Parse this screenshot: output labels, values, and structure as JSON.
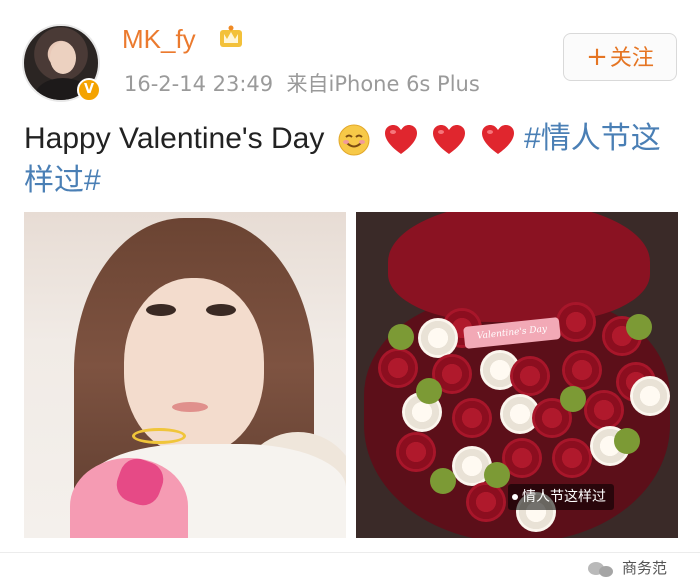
{
  "post": {
    "username": "MK_fy",
    "timestamp": "16-2-14 23:49",
    "source": "来自iPhone 6s Plus",
    "verified_badge": "V",
    "follow_label": "关注",
    "follow_icon": "+",
    "text_plain": "Happy Valentine's Day ",
    "emojis": [
      "smile-emoji",
      "heart-emoji",
      "heart-emoji",
      "heart-emoji"
    ],
    "hashtag": "#情人节这样过#",
    "images": [
      {
        "name": "selfie-photo"
      },
      {
        "name": "roses-photo",
        "tag": "情人节这样过",
        "ribbon": "Valentine's Day"
      }
    ]
  },
  "watermark": {
    "icon": "wechat-icon",
    "label": "商务范"
  },
  "colors": {
    "username": "#eb7a2e",
    "hashtag": "#4a7fb5",
    "meta": "#9a9a9a",
    "follow": "#e57523",
    "verified": "#f4a300",
    "heart": "#e0262e"
  }
}
